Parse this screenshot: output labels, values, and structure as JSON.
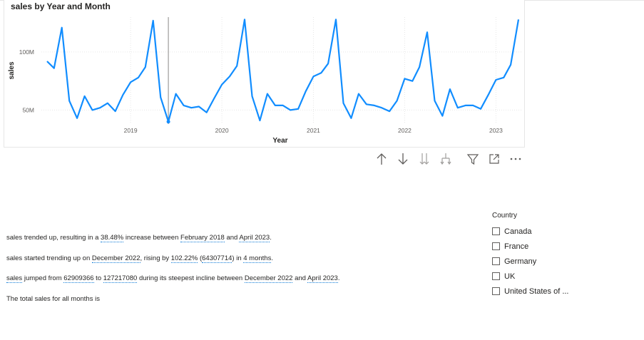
{
  "chart_data": {
    "type": "line",
    "title": "sales by Year and Month",
    "xlabel": "Year",
    "ylabel": "sales",
    "x_ticks": [
      "2019",
      "2020",
      "2021",
      "2022",
      "2023"
    ],
    "y_ticks": [
      "50M",
      "100M"
    ],
    "ylim": [
      38000000,
      130000000
    ],
    "grid": true,
    "color": "#118dff",
    "series": [
      {
        "x": [
          "2018-02",
          "2018-03",
          "2018-04",
          "2018-05",
          "2018-06",
          "2018-07",
          "2018-08",
          "2018-09",
          "2018-10",
          "2018-11",
          "2018-12",
          "2019-01",
          "2019-02",
          "2019-03",
          "2019-04",
          "2019-05",
          "2019-06",
          "2019-07",
          "2019-08",
          "2019-09",
          "2019-10",
          "2019-11",
          "2019-12",
          "2020-01",
          "2020-02",
          "2020-03",
          "2020-04",
          "2020-05",
          "2020-06",
          "2020-07",
          "2020-08",
          "2020-09",
          "2020-10",
          "2020-11",
          "2020-12",
          "2021-01",
          "2021-02",
          "2021-03",
          "2021-04",
          "2021-05",
          "2021-06",
          "2021-07",
          "2021-08",
          "2021-09",
          "2021-10",
          "2021-11",
          "2021-12",
          "2022-01",
          "2022-02",
          "2022-03",
          "2022-04",
          "2022-05",
          "2022-06",
          "2022-07",
          "2022-08",
          "2022-09",
          "2022-10",
          "2022-11",
          "2022-12",
          "2023-01",
          "2023-02",
          "2023-03",
          "2023-04"
        ],
        "values": [
          92000000,
          86000000,
          121000000,
          58000000,
          43000000,
          62000000,
          50000000,
          52000000,
          56000000,
          49000000,
          63000000,
          74000000,
          78000000,
          87000000,
          127000000,
          61000000,
          40000000,
          64000000,
          54000000,
          52000000,
          53000000,
          48000000,
          60000000,
          72000000,
          79000000,
          88000000,
          128000000,
          62000000,
          41000000,
          64000000,
          54000000,
          54000000,
          50000000,
          51000000,
          66000000,
          79000000,
          82000000,
          90000000,
          128000000,
          56000000,
          43000000,
          64000000,
          55000000,
          54000000,
          52000000,
          49000000,
          58000000,
          77000000,
          75000000,
          87000000,
          117000000,
          58000000,
          45000000,
          68000000,
          52000000,
          54000000,
          54000000,
          51000000,
          63000000,
          76000000,
          78000000,
          89000000,
          128000000
        ]
      }
    ]
  },
  "toolbar": {
    "icons": [
      "arrow-up-icon",
      "arrow-down-icon",
      "double-arrow-down-icon",
      "expand-hierarchy-icon",
      "filter-icon",
      "focus-mode-icon",
      "more-options-icon"
    ]
  },
  "narrative": {
    "p1": {
      "a": "sales trended up, resulting in a ",
      "pct": "38.48%",
      "b": " increase between ",
      "start": "February 2018",
      "c": " and ",
      "end": "April 2023",
      "d": "."
    },
    "p2": {
      "a": "sales started trending up on ",
      "start": "December 2022",
      "b": ", rising by ",
      "pct": "102.22%",
      "c": " (",
      "amt": "64307714",
      "d": ") in ",
      "dur": "4 months",
      "e": "."
    },
    "p3": {
      "measure": "sales",
      "a": " jumped from ",
      "from": "62909366",
      "b": " to ",
      "to": "127217080",
      "c": " during its steepest incline between ",
      "start": "December 2022",
      "d": " and ",
      "end": "April 2023",
      "e": "."
    },
    "p4": "The total sales for all months is"
  },
  "slicer": {
    "title": "Country",
    "items": [
      "Canada",
      "France",
      "Germany",
      "UK",
      "United States of ..."
    ]
  }
}
